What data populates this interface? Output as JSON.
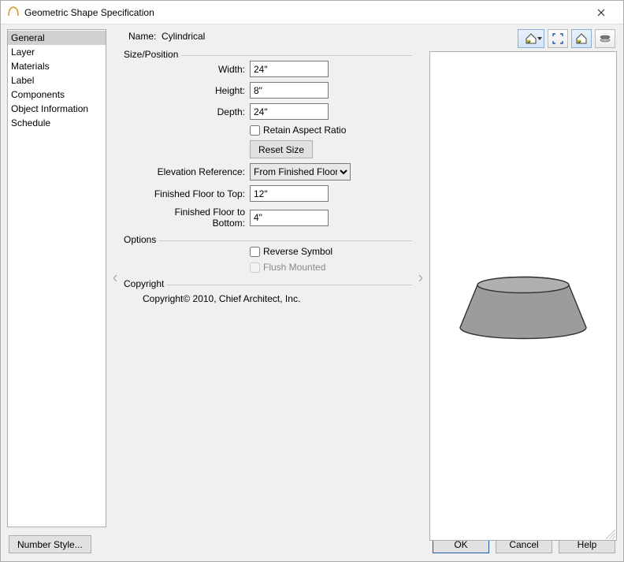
{
  "window": {
    "title": "Geometric Shape Specification"
  },
  "sidebar": {
    "items": [
      {
        "label": "General",
        "selected": true
      },
      {
        "label": "Layer"
      },
      {
        "label": "Materials"
      },
      {
        "label": "Label"
      },
      {
        "label": "Components"
      },
      {
        "label": "Object Information"
      },
      {
        "label": "Schedule"
      }
    ]
  },
  "main": {
    "name_label": "Name:",
    "name_value": "Cylindrical",
    "size_group": "Size/Position",
    "width_label": "Width:",
    "width_value": "24\"",
    "height_label": "Height:",
    "height_value": "8\"",
    "depth_label": "Depth:",
    "depth_value": "24\"",
    "retain_label": "Retain Aspect Ratio",
    "reset_label": "Reset Size",
    "elev_ref_label": "Elevation Reference:",
    "elev_ref_value": "From Finished Floor",
    "ff_top_label": "Finished Floor to Top:",
    "ff_top_value": "12\"",
    "ff_bot_label": "Finished Floor to Bottom:",
    "ff_bot_value": "4\"",
    "options_group": "Options",
    "reverse_label": "Reverse Symbol",
    "flush_label": "Flush Mounted",
    "copyright_group": "Copyright",
    "copyright_text": "Copyright© 2010, Chief Architect, Inc."
  },
  "footer": {
    "number_style": "Number Style...",
    "ok": "OK",
    "cancel": "Cancel",
    "help": "Help"
  }
}
